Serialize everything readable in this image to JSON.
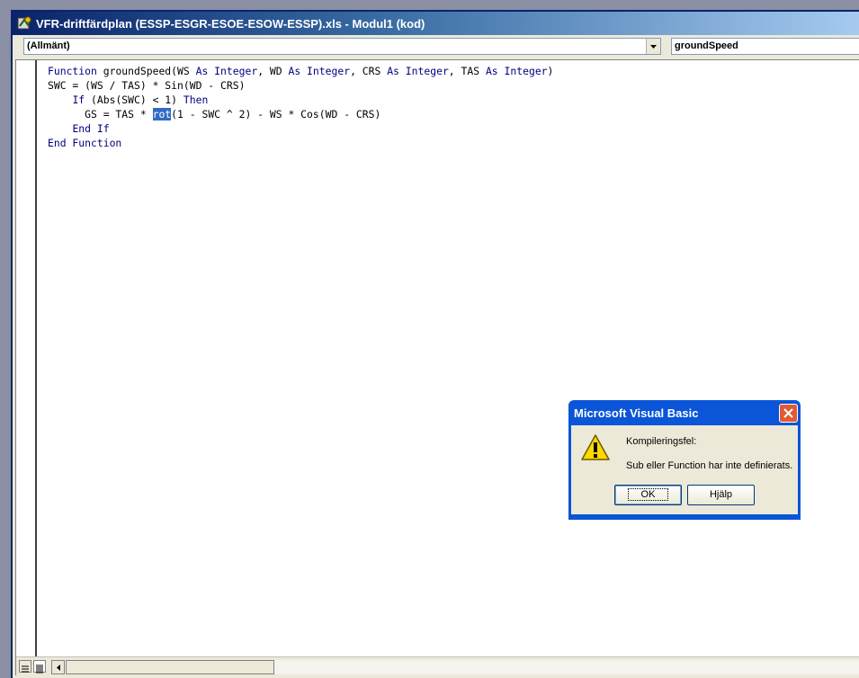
{
  "window": {
    "title": "VFR-driftfärdplan (ESSP-ESGR-ESOE-ESOW-ESSP).xls - Modul1 (kod)"
  },
  "selectors": {
    "object": "(Allmänt)",
    "procedure": "groundSpeed"
  },
  "code": {
    "line1_kw1": "Function",
    "line1_t1": " groundSpeed(WS ",
    "line1_kw2": "As Integer",
    "line1_t2": ", WD ",
    "line1_kw3": "As Integer",
    "line1_t3": ", CRS ",
    "line1_kw4": "As Integer",
    "line1_t4": ", TAS ",
    "line1_kw5": "As Integer",
    "line1_t5": ")",
    "line2": "SWC = (WS / TAS) * Sin(WD - CRS)",
    "line3_indent": "    ",
    "line3_kw1": "If",
    "line3_t1": " (Abs(SWC) < 1) ",
    "line3_kw2": "Then",
    "line4_t1": "      GS = TAS * ",
    "line4_sel": "rot",
    "line4_t2": "(1 - SWC ^ 2) - WS * Cos(WD - CRS)",
    "line5_indent": "    ",
    "line5_kw": "End If",
    "line6_kw": "End Function"
  },
  "dialog": {
    "title": "Microsoft Visual Basic",
    "message_title": "Kompileringsfel:",
    "message": "Sub eller Function har inte definierats.",
    "ok_label": "OK",
    "help_label": "Hjälp"
  }
}
